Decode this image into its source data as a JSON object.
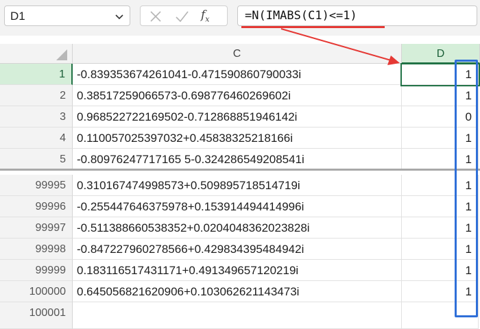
{
  "name_box": {
    "value": "D1"
  },
  "formula_bar": {
    "formula": "=N(IMABS(C1)<=1)"
  },
  "icons": {
    "chevron": "chevron-down-icon",
    "cancel": "cancel-x-icon",
    "enter": "check-icon",
    "function": "fx-icon"
  },
  "column_headers": [
    "C",
    "D"
  ],
  "colors": {
    "selection_green": "#217346",
    "annotation_red": "#e53935",
    "annotation_blue": "#2f6fd8"
  },
  "rows_top": [
    {
      "num": "1",
      "c": "-0.839353674261041-0.471590860790033i",
      "d": "1"
    },
    {
      "num": "2",
      "c": "0.38517259066573-0.698776460269602i",
      "d": "1"
    },
    {
      "num": "3",
      "c": "0.968522722169502-0.712868851946142i",
      "d": "0"
    },
    {
      "num": "4",
      "c": "0.110057025397032+0.45838325218166i",
      "d": "1"
    },
    {
      "num": "5",
      "c": "-0.80976247717165 5-0.324286549208541i",
      "d": "1"
    }
  ],
  "rows_bottom": [
    {
      "num": "99995",
      "c": "0.310167474998573+0.509895718514719i",
      "d": "1"
    },
    {
      "num": "99996",
      "c": "-0.255447646375978+0.153914494414996i",
      "d": "1"
    },
    {
      "num": "99997",
      "c": "-0.511388660538352+0.0204048362023828i",
      "d": "1"
    },
    {
      "num": "99998",
      "c": "-0.847227960278566+0.429834395484942i",
      "d": "1"
    },
    {
      "num": "99999",
      "c": "0.183116517431171+0.491349657120219i",
      "d": "1"
    },
    {
      "num": "100000",
      "c": "0.645056821620906+0.103062621143473i",
      "d": "1"
    },
    {
      "num": "100001",
      "c": "",
      "d": ""
    }
  ]
}
